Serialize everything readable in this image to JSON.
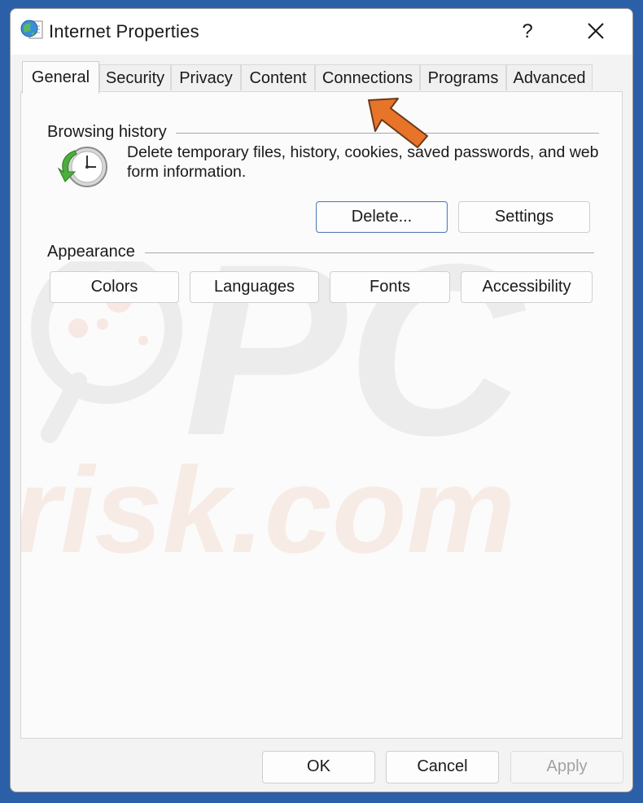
{
  "window": {
    "title": "Internet Properties",
    "help_glyph": "?",
    "close_icon": "close-icon"
  },
  "tabs": [
    {
      "label": "General",
      "active": true
    },
    {
      "label": "Security",
      "active": false
    },
    {
      "label": "Privacy",
      "active": false
    },
    {
      "label": "Content",
      "active": false
    },
    {
      "label": "Connections",
      "active": false
    },
    {
      "label": "Programs",
      "active": false
    },
    {
      "label": "Advanced",
      "active": false
    }
  ],
  "browsing_history": {
    "heading": "Browsing history",
    "description": "Delete temporary files, history, cookies, saved passwords, and web form information.",
    "delete_button": "Delete...",
    "settings_button": "Settings"
  },
  "appearance": {
    "heading": "Appearance",
    "buttons": [
      "Colors",
      "Languages",
      "Fonts",
      "Accessibility"
    ]
  },
  "footer": {
    "ok": "OK",
    "cancel": "Cancel",
    "apply": "Apply"
  },
  "watermark": {
    "line1": "PC",
    "line2": "risk.com"
  },
  "colors": {
    "accent_arrow": "#e8742a",
    "default_button_border": "#5a7fb8"
  },
  "icons": {
    "title": "internet-globe-icon",
    "history": "history-clock-icon",
    "pointer": "orange-arrow-icon"
  }
}
